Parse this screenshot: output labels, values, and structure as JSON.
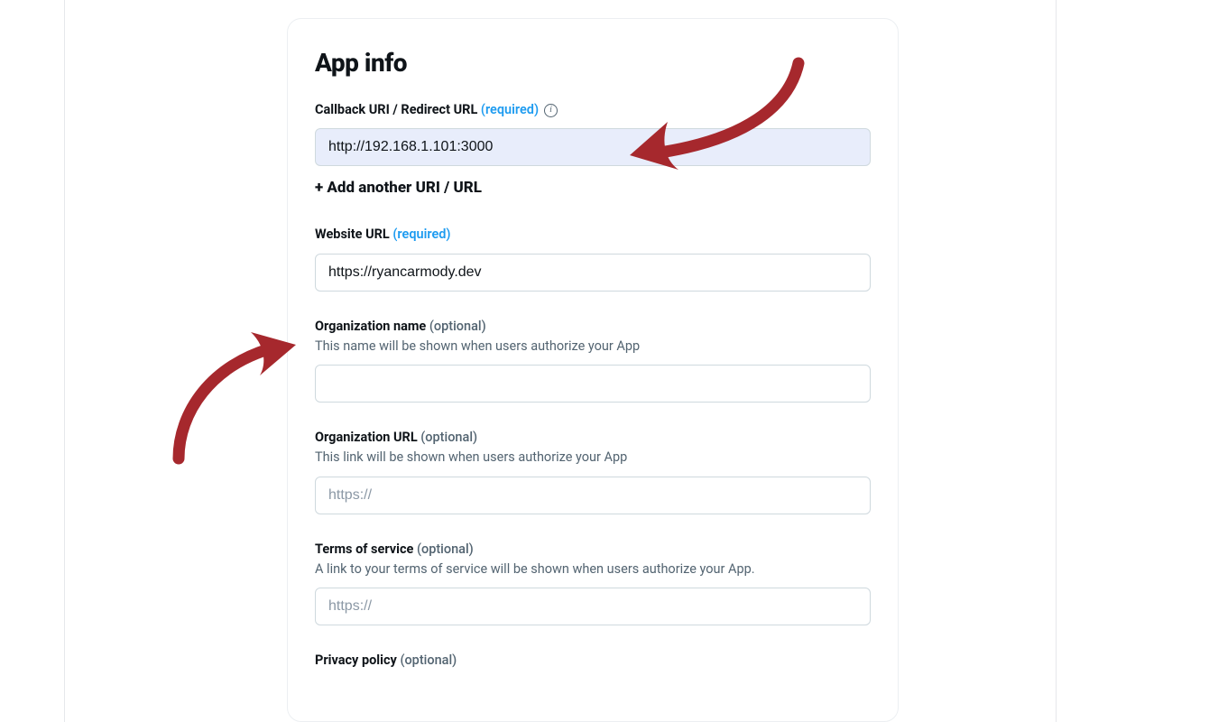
{
  "page": {
    "title": "App info"
  },
  "fields": {
    "callback": {
      "label": "Callback URI / Redirect URL",
      "required_tag": "(required)",
      "value": "http://192.168.1.101:3000",
      "add_another": "+ Add another URI / URL"
    },
    "website": {
      "label": "Website URL",
      "required_tag": "(required)",
      "value": "https://ryancarmody.dev"
    },
    "org_name": {
      "label": "Organization name",
      "optional_tag": "(optional)",
      "help": "This name will be shown when users authorize your App",
      "value": ""
    },
    "org_url": {
      "label": "Organization URL",
      "optional_tag": "(optional)",
      "help": "This link will be shown when users authorize your App",
      "placeholder": "https://",
      "value": ""
    },
    "tos": {
      "label": "Terms of service",
      "optional_tag": "(optional)",
      "help": "A link to your terms of service will be shown when users authorize your App.",
      "placeholder": "https://",
      "value": ""
    },
    "privacy": {
      "label": "Privacy policy",
      "optional_tag": "(optional)"
    }
  },
  "annotations": {
    "arrow_color": "#a6282d"
  }
}
